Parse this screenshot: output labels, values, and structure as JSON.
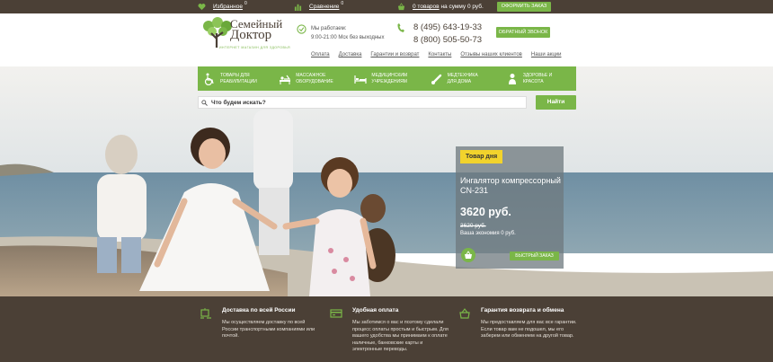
{
  "topbar": {
    "favorites_label": "Избранное",
    "favorites_count": "0",
    "compare_label": "Сравнение",
    "compare_count": "0",
    "cart_items": "0 товаров",
    "cart_sum_text": "на сумму 0 руб.",
    "order_button": "ОФОРМИТЬ ЗАКАЗ"
  },
  "header": {
    "logo_line1": "Семейный",
    "logo_line2": "Доктор",
    "logo_tagline": "ИНТЕРНЕТ МАГАЗИН ДЛЯ ЗДОРОВЬЯ",
    "hours_line1": "Мы работаем:",
    "hours_line2": "9:00-21:00 Мск без выходных",
    "phone1": "8 (495) 643-19-33",
    "phone2": "8 (800) 505-50-73",
    "callback_button": "ОБРАТНЫЙ ЗВОНОК",
    "nav": [
      "Оплата",
      "Доставка",
      "Гарантии и возврат",
      "Контакты",
      "Отзывы наших клиентов",
      "Наши акции"
    ]
  },
  "categories": [
    {
      "line1": "Товары для",
      "line2": "реабилитации",
      "icon": "wheelchair-icon"
    },
    {
      "line1": "Массажное",
      "line2": "оборудование",
      "icon": "massage-icon"
    },
    {
      "line1": "Медицинским",
      "line2": "учреждениям",
      "icon": "hospital-bed-icon"
    },
    {
      "line1": "Медтехника",
      "line2": "для дома",
      "icon": "thermometer-icon"
    },
    {
      "line1": "Здоровье и",
      "line2": "красота",
      "icon": "person-icon"
    }
  ],
  "search": {
    "placeholder": "Что будем искать?",
    "button": "Найти"
  },
  "deal": {
    "badge": "Товар дня",
    "name": "Ингалятор компрессорный CN-231",
    "price": "3620 руб.",
    "old_price": "3620 руб.",
    "savings": "Ваша экономия 0 руб.",
    "quick_order": "БЫСТРЫЙ ЗАКАЗ"
  },
  "features": [
    {
      "title": "Доставка по всей России",
      "desc": "Мы осуществляем доставку по всей России транспортными компаниями или почтой.",
      "icon": "delivery-icon"
    },
    {
      "title": "Удобная оплата",
      "desc": "Мы заботимся о вас и поэтому сделали процесс оплаты простым и быстрым. Для вашего удобства мы принимаем к оплате наличные, банковские карты и электронные переводы.",
      "icon": "payment-icon"
    },
    {
      "title": "Гарантия возврата и обмена",
      "desc": "Мы предоставляем для вас все гарантии. Если товар вам не подошел, мы его заберем или обменяем на другой товар.",
      "icon": "basket-icon"
    }
  ],
  "colors": {
    "brand_green": "#7ab648",
    "dark_brown": "#4b4036",
    "deal_badge": "#f2d32c"
  }
}
